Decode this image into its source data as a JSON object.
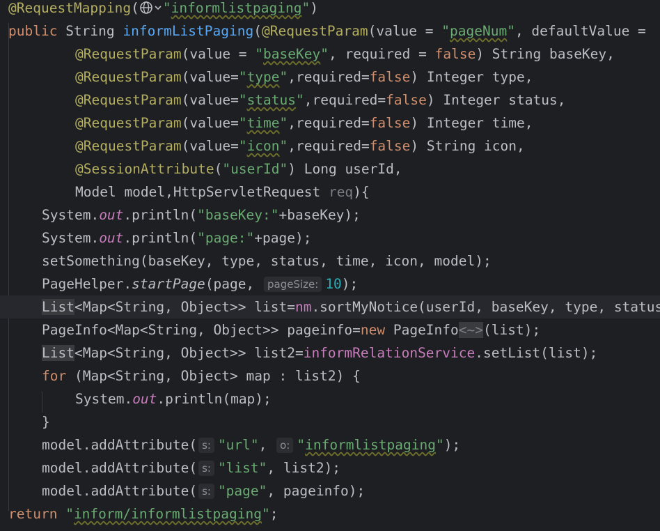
{
  "editor": {
    "lines": [
      {
        "indent": 0,
        "tokens": [
          {
            "t": "@RequestMapping",
            "c": "ann"
          },
          {
            "t": "("
          },
          {
            "icon": "globe"
          },
          {
            "t": "\"",
            "c": "str"
          },
          {
            "t": "informlistpaging",
            "c": "str warn"
          },
          {
            "t": "\"",
            "c": "str"
          },
          {
            "t": ")"
          }
        ]
      },
      {
        "indent": 0,
        "tokens": [
          {
            "t": "public ",
            "c": "kw"
          },
          {
            "t": "String "
          },
          {
            "t": "informListPaging",
            "c": "fn"
          },
          {
            "t": "("
          },
          {
            "t": "@RequestParam",
            "c": "ann"
          },
          {
            "t": "(value = "
          },
          {
            "t": "\"",
            "c": "str"
          },
          {
            "t": "pageNum",
            "c": "str warn"
          },
          {
            "t": "\"",
            "c": "str"
          },
          {
            "t": ", defaultValue ="
          }
        ]
      },
      {
        "indent": 4,
        "tokens": [
          {
            "t": "@RequestParam",
            "c": "ann"
          },
          {
            "t": "(value = "
          },
          {
            "t": "\"",
            "c": "str"
          },
          {
            "t": "baseKey",
            "c": "str warn"
          },
          {
            "t": "\"",
            "c": "str"
          },
          {
            "t": ", required = "
          },
          {
            "t": "false",
            "c": "kw"
          },
          {
            "t": ") String baseKey,"
          }
        ]
      },
      {
        "indent": 4,
        "tokens": [
          {
            "t": "@RequestParam",
            "c": "ann"
          },
          {
            "t": "(value="
          },
          {
            "t": "\"",
            "c": "str"
          },
          {
            "t": "type",
            "c": "str warn"
          },
          {
            "t": "\"",
            "c": "str"
          },
          {
            "t": ",required="
          },
          {
            "t": "false",
            "c": "kw"
          },
          {
            "t": ") Integer type,"
          }
        ]
      },
      {
        "indent": 4,
        "tokens": [
          {
            "t": "@RequestParam",
            "c": "ann"
          },
          {
            "t": "(value="
          },
          {
            "t": "\"",
            "c": "str"
          },
          {
            "t": "status",
            "c": "str warn"
          },
          {
            "t": "\"",
            "c": "str"
          },
          {
            "t": ",required="
          },
          {
            "t": "false",
            "c": "kw"
          },
          {
            "t": ") Integer status,"
          }
        ]
      },
      {
        "indent": 4,
        "tokens": [
          {
            "t": "@RequestParam",
            "c": "ann"
          },
          {
            "t": "(value="
          },
          {
            "t": "\"",
            "c": "str"
          },
          {
            "t": "time",
            "c": "str warn"
          },
          {
            "t": "\"",
            "c": "str"
          },
          {
            "t": ",required="
          },
          {
            "t": "false",
            "c": "kw"
          },
          {
            "t": ") Integer time,"
          }
        ]
      },
      {
        "indent": 4,
        "tokens": [
          {
            "t": "@RequestParam",
            "c": "ann"
          },
          {
            "t": "(value="
          },
          {
            "t": "\"",
            "c": "str"
          },
          {
            "t": "icon",
            "c": "str warn"
          },
          {
            "t": "\"",
            "c": "str"
          },
          {
            "t": ",required="
          },
          {
            "t": "false",
            "c": "kw"
          },
          {
            "t": ") String icon,"
          }
        ]
      },
      {
        "indent": 4,
        "tokens": [
          {
            "t": "@SessionAttribute",
            "c": "ann"
          },
          {
            "t": "("
          },
          {
            "t": "\"userId\"",
            "c": "str"
          },
          {
            "t": ") Long userId,"
          }
        ]
      },
      {
        "indent": 4,
        "tokens": [
          {
            "t": "Model model,HttpServletRequest "
          },
          {
            "t": "req",
            "c": "unused"
          },
          {
            "t": "){"
          }
        ]
      },
      {
        "indent": 2,
        "tokens": [
          {
            "t": "System."
          },
          {
            "t": "out",
            "c": "static"
          },
          {
            "t": ".println("
          },
          {
            "t": "\"baseKey:\"",
            "c": "str"
          },
          {
            "t": "+baseKey);"
          }
        ]
      },
      {
        "indent": 2,
        "tokens": [
          {
            "t": "System."
          },
          {
            "t": "out",
            "c": "static"
          },
          {
            "t": ".println("
          },
          {
            "t": "\"page:\"",
            "c": "str"
          },
          {
            "t": "+page);"
          }
        ]
      },
      {
        "indent": 2,
        "tokens": [
          {
            "t": "setSomething(baseKey, type, status, time, icon, model);"
          }
        ]
      },
      {
        "indent": 2,
        "tokens": [
          {
            "t": "PageHelper."
          },
          {
            "t": "startPage",
            "c": "italic"
          },
          {
            "t": "(page, "
          },
          {
            "hint": "pageSize:"
          },
          {
            "t": "10",
            "c": "num"
          },
          {
            "t": ");"
          }
        ]
      },
      {
        "indent": 2,
        "current": true,
        "tokens": [
          {
            "t": "List",
            "c": "hl"
          },
          {
            "t": "<Map<String, Object>> list="
          },
          {
            "t": "nm",
            "c": "field"
          },
          {
            "t": ".sortMyNotice(userId, baseKey, type, status, time, icon);"
          }
        ]
      },
      {
        "indent": 2,
        "tokens": [
          {
            "t": "PageInfo<Map<String, Object>> pageinfo="
          },
          {
            "t": "new ",
            "c": "kw"
          },
          {
            "t": "PageInfo"
          },
          {
            "t": "<~>",
            "c": "unused hl"
          },
          {
            "t": "(list);"
          }
        ]
      },
      {
        "indent": 2,
        "tokens": [
          {
            "t": "List",
            "c": "hl"
          },
          {
            "t": "<Map<String, Object>> list2="
          },
          {
            "t": "informRelationService",
            "c": "field"
          },
          {
            "t": ".setList(list);"
          }
        ]
      },
      {
        "indent": 2,
        "tokens": [
          {
            "t": "for ",
            "c": "kw"
          },
          {
            "t": "(Map<String, Object> map : list2) {"
          }
        ]
      },
      {
        "indent": 4,
        "tokens": [
          {
            "t": "System."
          },
          {
            "t": "out",
            "c": "static"
          },
          {
            "t": ".println(map);"
          }
        ]
      },
      {
        "indent": 2,
        "tokens": [
          {
            "t": "}"
          }
        ]
      },
      {
        "indent": 2,
        "tokens": [
          {
            "t": "model.addAttribute("
          },
          {
            "hint": "s:"
          },
          {
            "t": "\"url\"",
            "c": "str"
          },
          {
            "t": ", "
          },
          {
            "hint": "o:"
          },
          {
            "t": "\"",
            "c": "str"
          },
          {
            "t": "informlistpaging",
            "c": "str warn"
          },
          {
            "t": "\"",
            "c": "str"
          },
          {
            "t": ");"
          }
        ]
      },
      {
        "indent": 2,
        "tokens": [
          {
            "t": "model.addAttribute("
          },
          {
            "hint": "s:"
          },
          {
            "t": "\"list\"",
            "c": "str"
          },
          {
            "t": ", list2);"
          }
        ]
      },
      {
        "indent": 2,
        "tokens": [
          {
            "t": "model.addAttribute("
          },
          {
            "hint": "s:"
          },
          {
            "t": "\"page\"",
            "c": "str"
          },
          {
            "t": ", pageinfo);"
          }
        ]
      },
      {
        "indent": 0,
        "tokens": [
          {
            "t": "return ",
            "c": "kw"
          },
          {
            "t": "\"",
            "c": "str"
          },
          {
            "t": "inform/informlistpaging",
            "c": "str warn"
          },
          {
            "t": "\"",
            "c": "str"
          },
          {
            "t": ";"
          }
        ]
      }
    ]
  }
}
